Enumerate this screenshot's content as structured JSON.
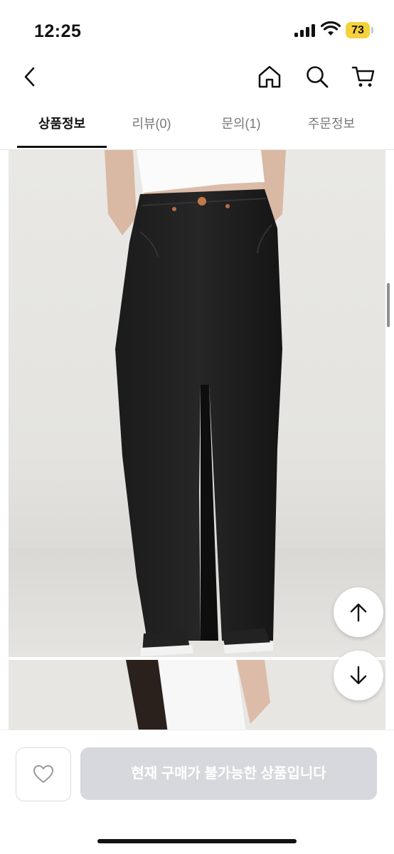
{
  "status_bar": {
    "time": "12:25",
    "battery": "73"
  },
  "nav": {
    "back_icon": "chevron-left-icon",
    "home_icon": "home-icon",
    "search_icon": "search-icon",
    "cart_icon": "cart-icon"
  },
  "tabs": [
    {
      "label": "상품정보",
      "active": true
    },
    {
      "label": "리뷰(0)",
      "active": false
    },
    {
      "label": "문의(1)",
      "active": false
    },
    {
      "label": "주문정보",
      "active": false
    }
  ],
  "scroll_buttons": {
    "up_icon": "arrow-up-icon",
    "down_icon": "arrow-down-icon"
  },
  "bottom_bar": {
    "like_icon": "heart-icon",
    "buy_label": "현재 구매가 불가능한 상품입니다"
  },
  "colors": {
    "accent": "#111111",
    "disabled_button": "#d7d8dd",
    "battery": "#f5d23a"
  }
}
